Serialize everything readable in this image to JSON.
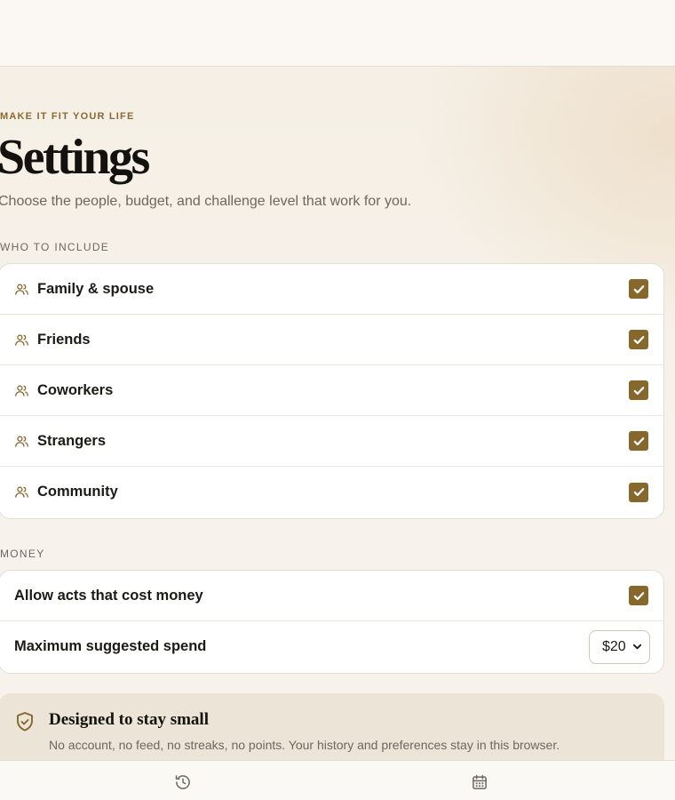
{
  "header": {
    "eyebrow": "MAKE IT FIT YOUR LIFE",
    "title": "Settings",
    "subtitle": "Choose the people, budget, and challenge level that work for you."
  },
  "who": {
    "label": "WHO TO INCLUDE",
    "items": [
      {
        "label": "Family & spouse",
        "icon": "people-icon",
        "checked": true
      },
      {
        "label": "Friends",
        "icon": "people-icon",
        "checked": true
      },
      {
        "label": "Coworkers",
        "icon": "people-icon",
        "checked": true
      },
      {
        "label": "Strangers",
        "icon": "people-icon",
        "checked": true
      },
      {
        "label": "Community",
        "icon": "people-icon",
        "checked": true
      }
    ]
  },
  "money": {
    "label": "MONEY",
    "allow_label": "Allow acts that cost money",
    "allow_checked": true,
    "max_label": "Maximum suggested spend",
    "max_value": "$20"
  },
  "notice": {
    "icon": "shield-check-icon",
    "title": "Designed to stay small",
    "text": "No account, no feed, no streaks, no points. Your history and preferences stay in this browser."
  },
  "nav": {
    "items": [
      {
        "icon": "history-icon"
      },
      {
        "icon": "calendar-icon"
      }
    ]
  },
  "colors": {
    "accent": "#86672c",
    "background": "#f6f1e7",
    "card": "#ffffff",
    "notice": "#ebe4d7"
  }
}
